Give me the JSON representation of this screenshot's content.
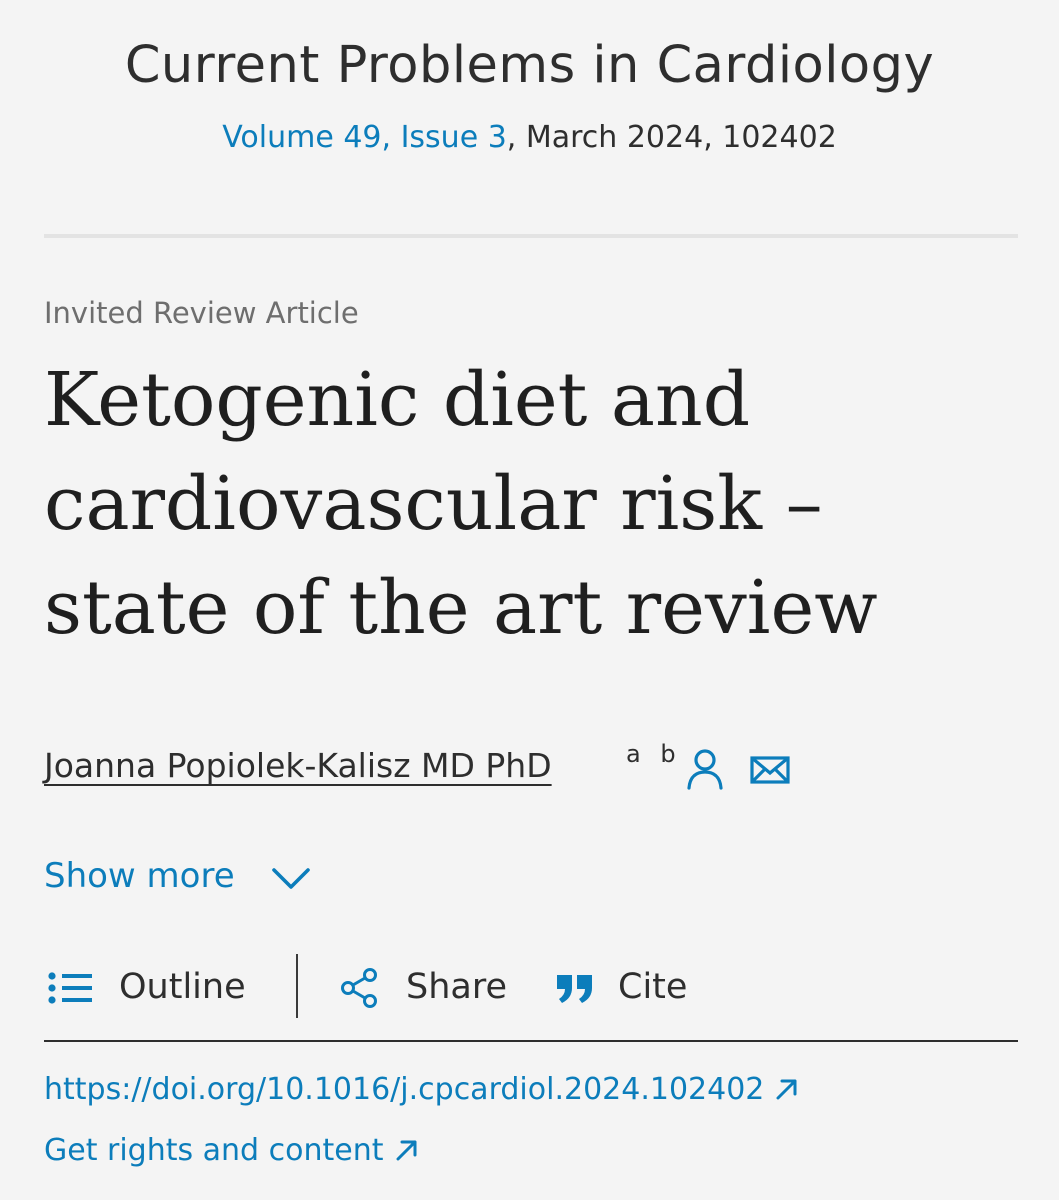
{
  "journal": {
    "title": "Current Problems in Cardiology",
    "volume_issue_link": "Volume 49, Issue 3",
    "issue_details": ", March 2024, 102402"
  },
  "article": {
    "type": "Invited Review Article",
    "title": "Ketogenic diet and cardiovascular risk – state of the art review"
  },
  "author": {
    "name": "Joanna Popiolek-Kalisz MD PhD",
    "affiliations": "a b",
    "profile_icon": "person-icon",
    "email_icon": "envelope-icon"
  },
  "show_more": {
    "label": "Show more",
    "icon": "chevron-down-icon"
  },
  "toolbar": {
    "outline_label": "Outline",
    "outline_icon": "list-icon",
    "share_label": "Share",
    "share_icon": "share-icon",
    "cite_label": "Cite",
    "cite_icon": "quote-icon"
  },
  "links": {
    "doi": "https://doi.org/10.1016/j.cpcardiol.2024.102402",
    "rights": "Get rights and content",
    "external_icon": "external-link-icon"
  },
  "colors": {
    "background": "#f4f4f4",
    "link": "#0c7dbb",
    "text": "#2e2e2e",
    "muted": "#6e6e6e"
  }
}
